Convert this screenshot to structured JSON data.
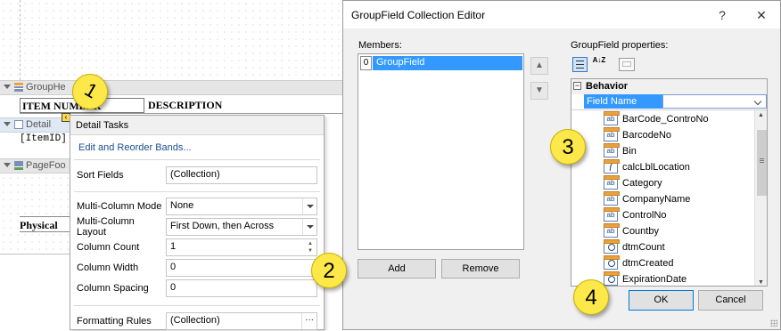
{
  "designer": {
    "group_header_label": "GroupHe",
    "col_item_number": "ITEM NUMBER",
    "col_description": "DESCRIPTION",
    "detail_label": "Detail",
    "item_id": "[ItemID]",
    "page_footer_label": "PageFoo",
    "physical_label": "Physical"
  },
  "tasks": {
    "title": "Detail Tasks",
    "edit_link": "Edit and Reorder Bands...",
    "sort_fields_label": "Sort Fields",
    "sort_fields_value": "(Collection)",
    "mc_mode_label": "Multi-Column Mode",
    "mc_mode_value": "None",
    "mc_layout_label": "Multi-Column Layout",
    "mc_layout_value": "First Down, then Across",
    "col_count_label": "Column Count",
    "col_count_value": "1",
    "col_width_label": "Column Width",
    "col_width_value": "0",
    "col_spacing_label": "Column Spacing",
    "col_spacing_value": "0",
    "formatting_label": "Formatting Rules",
    "formatting_value": "(Collection)",
    "ellipsis": "···"
  },
  "dialog": {
    "title": "GroupField Collection Editor",
    "help": "?",
    "close": "✕",
    "members_label": "Members:",
    "member_index": "0",
    "member_name": "GroupField",
    "properties_label": "GroupField properties:",
    "az_icon": "A↓Z",
    "category": "Behavior",
    "field_name_label": "Field Name",
    "fields": [
      {
        "name": "BarCode_ControNo",
        "icon": "ab"
      },
      {
        "name": "BarcodeNo",
        "icon": "ab"
      },
      {
        "name": "Bin",
        "icon": "ab"
      },
      {
        "name": "calcLblLocation",
        "icon": "f"
      },
      {
        "name": "Category",
        "icon": "ab"
      },
      {
        "name": "CompanyName",
        "icon": "ab"
      },
      {
        "name": "ControlNo",
        "icon": "ab"
      },
      {
        "name": "Countby",
        "icon": "ab"
      },
      {
        "name": "dtmCount",
        "icon": "clock"
      },
      {
        "name": "dtmCreated",
        "icon": "clock"
      },
      {
        "name": "ExpirationDate",
        "icon": "clock"
      }
    ],
    "add_label": "Add",
    "remove_label": "Remove",
    "ok_label": "OK",
    "cancel_label": "Cancel"
  },
  "callouts": [
    "1",
    "2",
    "3",
    "4"
  ],
  "colors": {
    "callout": "#fde84a",
    "selection": "#3399ff",
    "link": "#1b4e8f"
  }
}
